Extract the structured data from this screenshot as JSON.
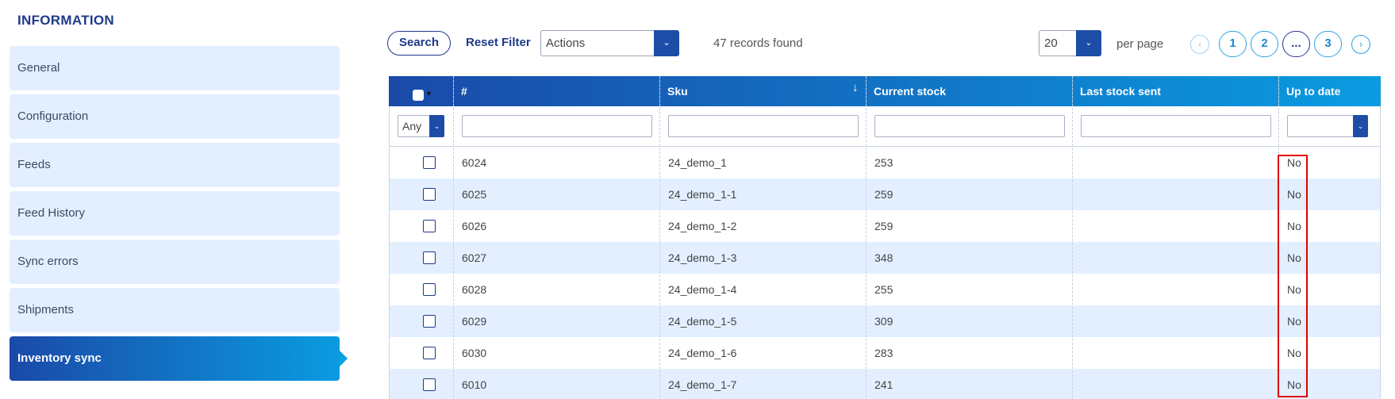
{
  "sidebar": {
    "title": "INFORMATION",
    "items": [
      {
        "label": "General",
        "active": false
      },
      {
        "label": "Configuration",
        "active": false
      },
      {
        "label": "Feeds",
        "active": false
      },
      {
        "label": "Feed History",
        "active": false
      },
      {
        "label": "Sync errors",
        "active": false
      },
      {
        "label": "Shipments",
        "active": false
      },
      {
        "label": "Inventory sync",
        "active": true
      }
    ]
  },
  "toolbar": {
    "search_label": "Search",
    "reset_label": "Reset Filter",
    "actions_value": "Actions",
    "records_text": "47 records found",
    "per_page_value": "20",
    "per_page_label": "per page"
  },
  "pagination": {
    "pages": [
      "1",
      "2",
      "...",
      "3"
    ],
    "prev_icon": "chevron-left-icon",
    "next_icon": "chevron-right-icon"
  },
  "table": {
    "columns": [
      "#",
      "Sku",
      "Current stock",
      "Last stock sent",
      "Up to date"
    ],
    "sort_icon": "↓",
    "filter_any": "Any",
    "rows": [
      {
        "id": "6024",
        "sku": "24_demo_1",
        "stock": "253",
        "last_sent": "",
        "up_to_date": "No"
      },
      {
        "id": "6025",
        "sku": "24_demo_1-1",
        "stock": "259",
        "last_sent": "",
        "up_to_date": "No"
      },
      {
        "id": "6026",
        "sku": "24_demo_1-2",
        "stock": "259",
        "last_sent": "",
        "up_to_date": "No"
      },
      {
        "id": "6027",
        "sku": "24_demo_1-3",
        "stock": "348",
        "last_sent": "",
        "up_to_date": "No"
      },
      {
        "id": "6028",
        "sku": "24_demo_1-4",
        "stock": "255",
        "last_sent": "",
        "up_to_date": "No"
      },
      {
        "id": "6029",
        "sku": "24_demo_1-5",
        "stock": "309",
        "last_sent": "",
        "up_to_date": "No"
      },
      {
        "id": "6030",
        "sku": "24_demo_1-6",
        "stock": "283",
        "last_sent": "",
        "up_to_date": "No"
      },
      {
        "id": "6010",
        "sku": "24_demo_1-7",
        "stock": "241",
        "last_sent": "",
        "up_to_date": "No"
      }
    ]
  },
  "colors": {
    "brand_dark": "#1e3a8a",
    "gradient_start": "#1a4aa8",
    "gradient_end": "#0a9be0",
    "row_alt": "#e3efff",
    "highlight": "#e00000"
  }
}
